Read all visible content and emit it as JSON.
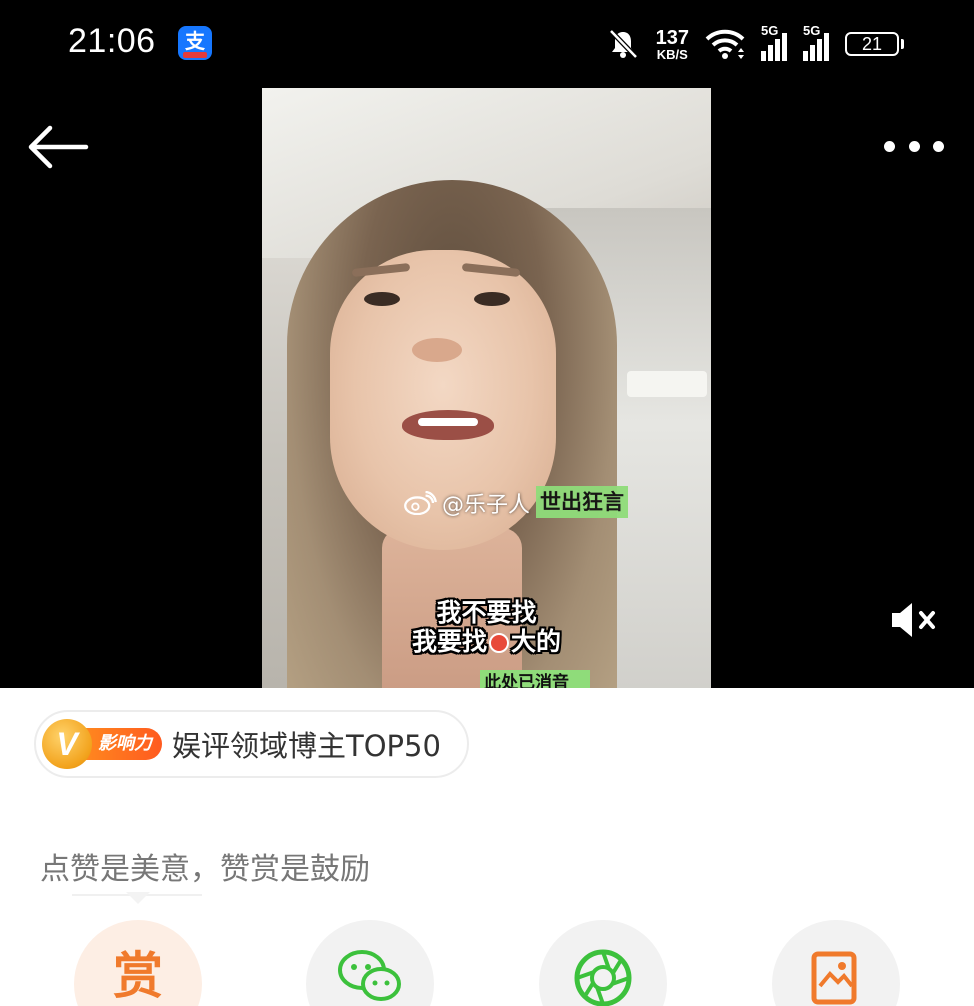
{
  "status_bar": {
    "time": "21:06",
    "app_icon": "alipay-icon",
    "alipay_glyph": "支",
    "net_speed_value": "137",
    "net_speed_unit": "KB/S",
    "signal1_label": "5G",
    "signal2_label": "5G",
    "battery_level": "21",
    "icons": [
      "mute-bell-icon",
      "wifi-icon",
      "signal-5g-icon",
      "signal-5g-icon",
      "battery-icon"
    ]
  },
  "player": {
    "back_icon": "back-arrow-icon",
    "more_icon": "more-dots-icon",
    "mute_icon": "speaker-muted-icon",
    "watermark_handle_a": "@乐子人",
    "watermark_handle_b": "出狂言",
    "watermark_tag": "世",
    "subtitle_line1": "我不要找",
    "subtitle_line2_a": "我要找",
    "subtitle_line2_b": "大的",
    "subtitle_partial": "此处已消音"
  },
  "sheet": {
    "influence_badge_v": "V",
    "influence_badge_label": "影响力",
    "influence_text": "娱评领域博主TOP50",
    "encourage_text": "点赞是美意，赞赏是鼓励",
    "actions": [
      {
        "name": "reward",
        "label": "赏",
        "icon": "reward-icon"
      },
      {
        "name": "wechat",
        "icon": "wechat-icon"
      },
      {
        "name": "moments",
        "icon": "moments-icon"
      },
      {
        "name": "save-image",
        "icon": "save-image-icon"
      }
    ]
  },
  "colors": {
    "accent_orange": "#f07a2c",
    "badge_orange": "#ff6a1f",
    "wechat_green": "#3cc13c",
    "subtitle_green": "#8fdc7a",
    "alipay_blue": "#1677ff"
  }
}
